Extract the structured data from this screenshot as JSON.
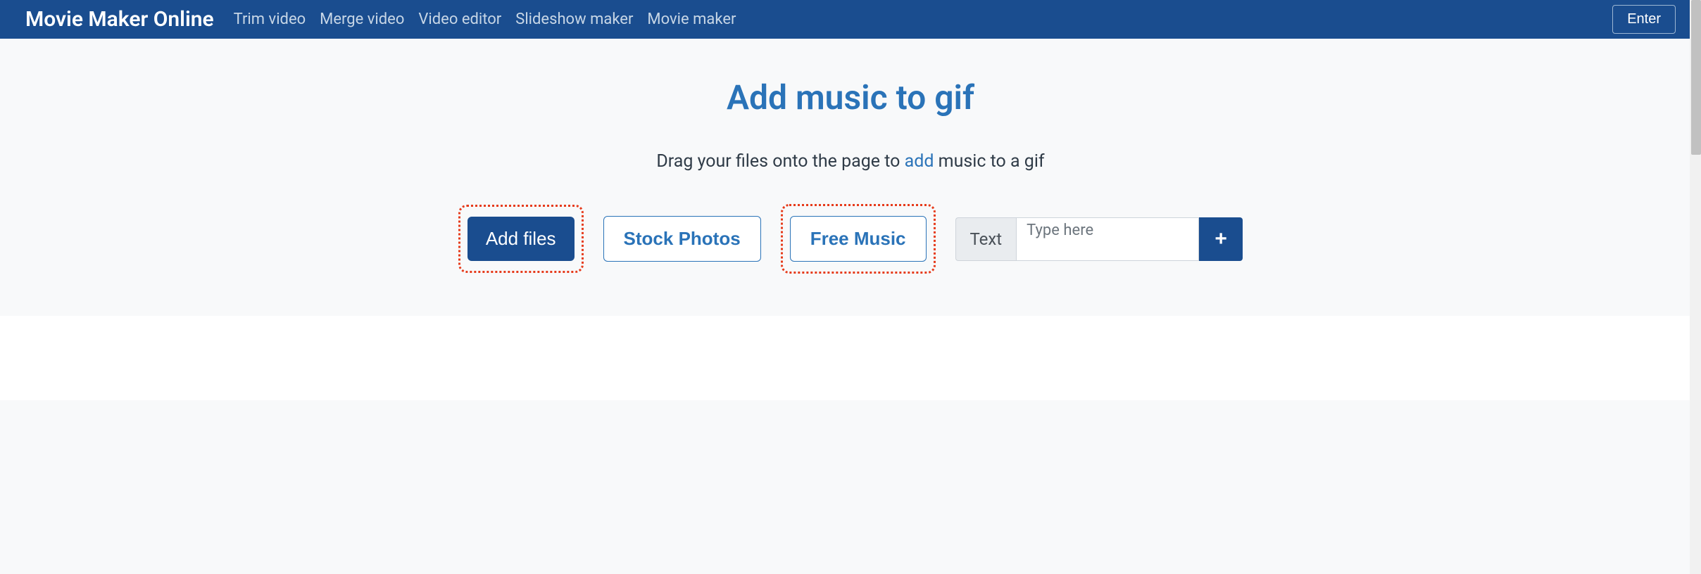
{
  "nav": {
    "brand": "Movie Maker Online",
    "links": [
      "Trim video",
      "Merge video",
      "Video editor",
      "Slideshow maker",
      "Movie maker"
    ],
    "enter": "Enter"
  },
  "hero": {
    "title": "Add music to gif",
    "subtitle_pre": "Drag your files onto the page to ",
    "subtitle_link": "add",
    "subtitle_post": " music to a gif"
  },
  "actions": {
    "add_files": "Add files",
    "stock_photos": "Stock Photos",
    "free_music": "Free Music",
    "text_label": "Text",
    "text_placeholder": "Type here",
    "plus": "+"
  }
}
